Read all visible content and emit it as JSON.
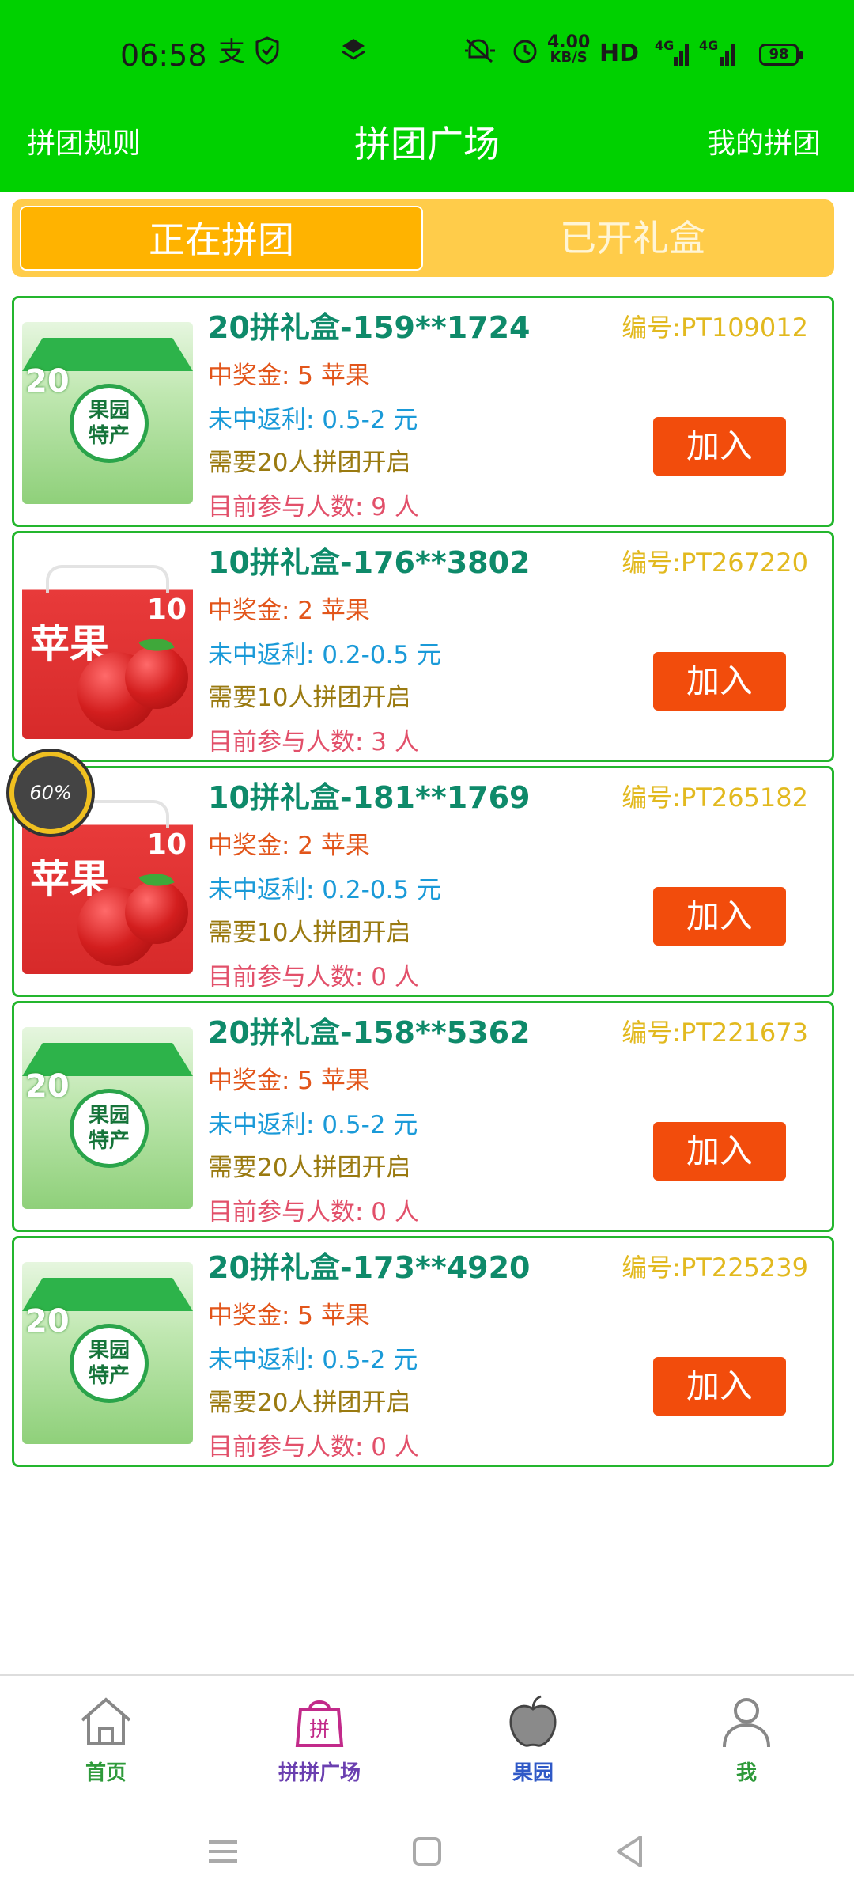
{
  "status_bar": {
    "time": "06:58",
    "speed_value": "4.00",
    "speed_unit": "KB/S",
    "hd": "HD",
    "net1": "4G",
    "net2": "4G",
    "battery": "98",
    "icons": [
      "alipay-icon",
      "shield-icon",
      "layers-icon",
      "mute-icon",
      "alarm-icon"
    ]
  },
  "header": {
    "left": "拼团规则",
    "title": "拼团广场",
    "right": "我的拼团"
  },
  "tabs": {
    "active": "正在拼团",
    "inactive": "已开礼盒"
  },
  "cards": [
    {
      "title": "20拼礼盒-159**1724",
      "id": "编号:PT109012",
      "prize": "中奖金: 5 苹果",
      "rebate": "未中返利: 0.5-2 元",
      "need": "需要20人拼团开启",
      "count": "目前参与人数: 9 人",
      "join": "加入",
      "image": "orchard-gift-box-green"
    },
    {
      "title": "10拼礼盒-176**3802",
      "id": "编号:PT267220",
      "prize": "中奖金: 2 苹果",
      "rebate": "未中返利: 0.2-0.5 元",
      "need": "需要10人拼团开启",
      "count": "目前参与人数: 3 人",
      "join": "加入",
      "image": "apple-gift-box-red"
    },
    {
      "title": "10拼礼盒-181**1769",
      "id": "编号:PT265182",
      "prize": "中奖金: 2 苹果",
      "rebate": "未中返利: 0.2-0.5 元",
      "need": "需要10人拼团开启",
      "count": "目前参与人数: 0 人",
      "join": "加入",
      "image": "apple-gift-box-red"
    },
    {
      "title": "20拼礼盒-158**5362",
      "id": "编号:PT221673",
      "prize": "中奖金: 5 苹果",
      "rebate": "未中返利: 0.5-2 元",
      "need": "需要20人拼团开启",
      "count": "目前参与人数: 0 人",
      "join": "加入",
      "image": "orchard-gift-box-green"
    },
    {
      "title": "20拼礼盒-173**4920",
      "id": "编号:PT225239",
      "prize": "中奖金: 5 苹果",
      "rebate": "未中返利: 0.5-2 元",
      "need": "需要20人拼团开启",
      "count": "目前参与人数: 0 人",
      "join": "加入",
      "image": "orchard-gift-box-green"
    }
  ],
  "box_art": {
    "green_badge_num": "20",
    "green_badge_line1": "果园",
    "green_badge_line2": "特产",
    "red_title": "苹果",
    "red_num": "10"
  },
  "float_progress": {
    "label": "60%",
    "value": 0.6
  },
  "bottom_nav": [
    {
      "label": "首页",
      "icon": "home-icon",
      "color": "#2e9a3a"
    },
    {
      "label": "拼拼广场",
      "icon": "shopping-bag-icon",
      "color": "#6a3fb0"
    },
    {
      "label": "果园",
      "icon": "apple-icon",
      "color": "#2f59c7"
    },
    {
      "label": "我",
      "icon": "user-icon",
      "color": "#2e9a3a"
    }
  ],
  "colors": {
    "header_green": "#00d100",
    "tab_bg": "#ffcc4a",
    "tab_active": "#ffb300",
    "card_border": "#24b62e",
    "join_button": "#f24c0c"
  }
}
